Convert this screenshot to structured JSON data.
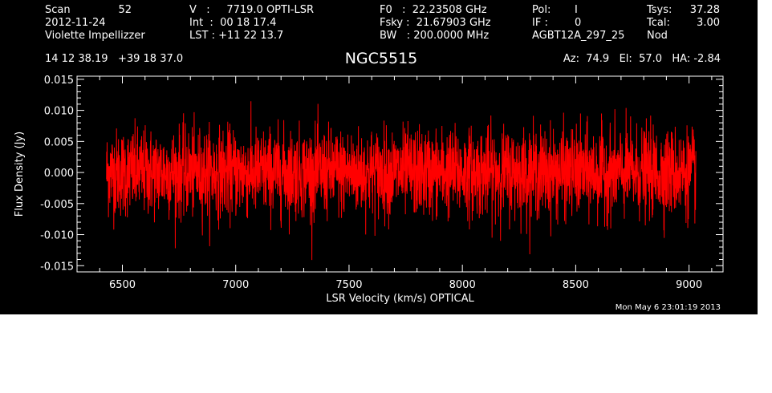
{
  "header": {
    "col1": {
      "scan_label": "Scan",
      "scan_value": "52",
      "date": "2012-11-24",
      "observer": "Violette Impellizzer"
    },
    "col2": {
      "v_line": "V   :     7719.0 OPTI-LSR",
      "int_line": "Int  :  00 18 17.4",
      "lst_line": "LST : +11 22 13.7"
    },
    "col3": {
      "f0_line": "F0   :  22.23508 GHz",
      "fsky_line": "Fsky :  21.67903 GHz",
      "bw_line": "BW   : 200.0000 MHz"
    },
    "col4": {
      "pol_label": "Pol:",
      "pol_value": "I",
      "if_label": "IF :",
      "if_value": "0",
      "project": "AGBT12A_297_25"
    },
    "col5": {
      "tsys_label": "Tsys:",
      "tsys_value": "37.28",
      "tcal_label": "Tcal:",
      "tcal_value": "3.00",
      "mode": "Nod"
    },
    "coords": "14 12 38.19   +39 18 37.0",
    "source": "NGC5515",
    "pointing": "Az:  74.9   El:  57.0   HA: -2.84"
  },
  "timestamp": "Mon May  6 23:01:19 2013",
  "chart_data": {
    "type": "line",
    "xlabel": "LSR Velocity (km/s) OPTICAL",
    "ylabel": "Flux Density (Jy)",
    "xlim": [
      6300,
      9150
    ],
    "ylim": [
      -0.016,
      0.0155
    ],
    "x_ticks": [
      6500,
      7000,
      7500,
      8000,
      8500,
      9000
    ],
    "x_tick_labels": [
      "6500",
      "7000",
      "7500",
      "8000",
      "8500",
      "9000"
    ],
    "y_ticks": [
      -0.015,
      -0.01,
      -0.005,
      0.0,
      0.005,
      0.01,
      0.015
    ],
    "y_tick_labels": [
      "-0.015",
      "-0.010",
      "-0.005",
      "0.000",
      "0.005",
      "0.010",
      "0.015"
    ],
    "series": [
      {
        "color": "#ff0000",
        "x_range": [
          6430,
          9030
        ],
        "rms": 0.0035,
        "baseline": 0.0
      }
    ]
  }
}
